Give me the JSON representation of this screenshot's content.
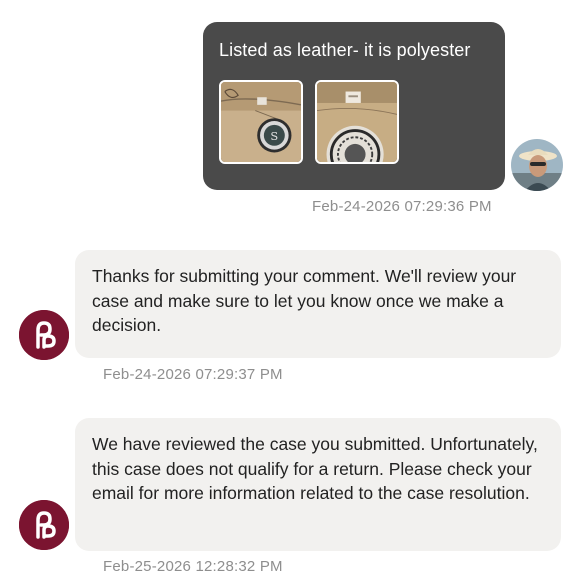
{
  "messages": [
    {
      "sender": "user",
      "text": "Listed as leather- it is polyester",
      "attachments": [
        {
          "icon": "photo-thumbnail-tag-closeup"
        },
        {
          "icon": "photo-thumbnail-lining-emblem"
        }
      ],
      "timestamp": "Feb-24-2026 07:29:36 PM"
    },
    {
      "sender": "support",
      "text": "Thanks for submitting your comment. We'll review your case and make sure to let you know once we make a decision.",
      "timestamp": "Feb-24-2026 07:29:37 PM"
    },
    {
      "sender": "support",
      "text": "We have reviewed the case you submitted. Unfortunately, this case does not qualify for a return. Please check your email for more information related to the case resolution.",
      "timestamp": "Feb-25-2026 12:28:32 PM"
    }
  ],
  "colors": {
    "user_bubble": "#4a4a4a",
    "support_bubble": "#f2f1ef",
    "brand_avatar": "#7b1430",
    "timestamp": "#8e8e8e"
  }
}
